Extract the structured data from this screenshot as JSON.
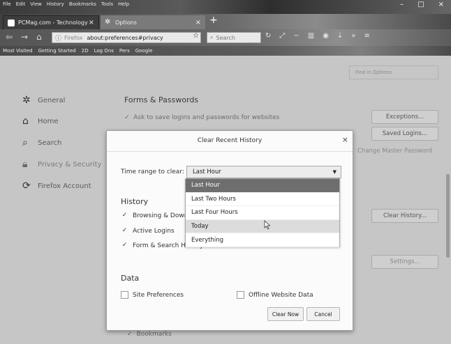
{
  "menu": [
    "File",
    "Edit",
    "View",
    "History",
    "Bookmarks",
    "Tools",
    "Help"
  ],
  "tabs": [
    {
      "label": "PCMag.com - Technology",
      "close": "×"
    },
    {
      "label": "Options",
      "close": "×"
    }
  ],
  "new_tab": "+",
  "window_controls": [
    "–",
    "□",
    "×"
  ],
  "nav": {
    "url_prefix": "Firefox",
    "url": "about:preferences#privacy",
    "search_placeholder": "Search"
  },
  "bookmarks": [
    "Most Visited",
    "Getting Started",
    "2D",
    "Log Ons",
    "Pers",
    "Google"
  ],
  "prefs": {
    "find_placeholder": "Find in Options",
    "sidebar": [
      "General",
      "Home",
      "Search",
      "Privacy & Security",
      "Firefox Account"
    ],
    "section_title": "Forms & Passwords",
    "ask_logins": "Ask to save logins and passwords for websites",
    "exceptions_btn": "Exceptions...",
    "saved_logins_btn": "Saved Logins...",
    "master_password": "Change Master Password",
    "clear_history_btn": "Clear History...",
    "settings_btn": "Settings...",
    "bookmarks_cb": "Bookmarks"
  },
  "dialog": {
    "title": "Clear Recent History",
    "close": "×",
    "time_range_label": "Time range to clear:",
    "time_range_value": "Last Hour",
    "options": [
      "Last Hour",
      "Last Two Hours",
      "Last Four Hours",
      "Today",
      "Everything"
    ],
    "history_heading": "History",
    "history_items": [
      "Browsing & Down",
      "Active Logins",
      "Form & Search History"
    ],
    "data_heading": "Data",
    "site_prefs": "Site Preferences",
    "offline_data": "Offline Website Data",
    "clear_now": "Clear Now",
    "cancel": "Cancel"
  }
}
